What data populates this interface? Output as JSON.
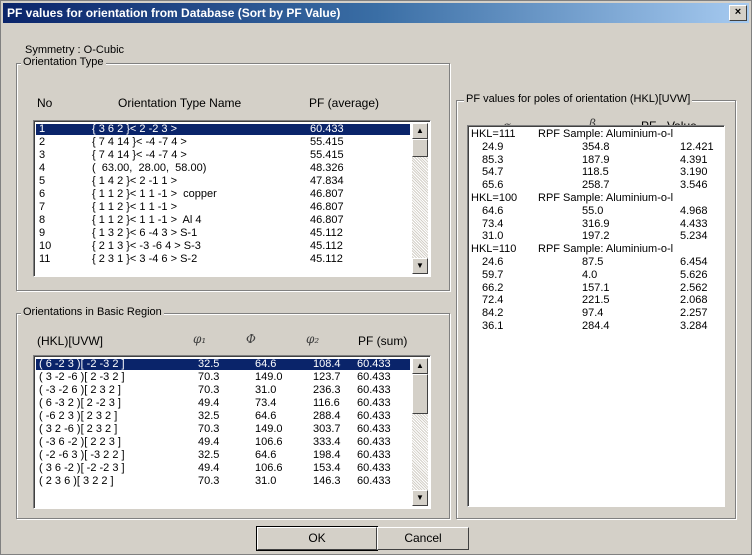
{
  "window": {
    "title": "PF values for orientation from Database (Sort by PF Value)",
    "close_label": "×"
  },
  "symmetry": "Symmetry :  O-Cubic",
  "orientation_type": {
    "legend": "Orientation Type",
    "col_no": "No",
    "col_name": "Orientation Type Name",
    "col_pf": "PF  (average)",
    "rows": [
      {
        "no": "1",
        "name": "{ 3 6 2 }< 2 -2 3 >",
        "pf": "60.433"
      },
      {
        "no": "2",
        "name": "{ 7 4 14 }< -4 -7 4 >",
        "pf": "55.415"
      },
      {
        "no": "3",
        "name": "{ 7 4 14 }< -4 -7 4 >",
        "pf": "55.415"
      },
      {
        "no": "4",
        "name": "(  63.00,  28.00,  58.00)",
        "pf": "48.326"
      },
      {
        "no": "5",
        "name": "{ 1 4 2 }< 2 -1 1 >",
        "pf": "47.834"
      },
      {
        "no": "6",
        "name": "{ 1 1 2 }< 1 1 -1 >  copper",
        "pf": "46.807"
      },
      {
        "no": "7",
        "name": "{ 1 1 2 }< 1 1 -1 >",
        "pf": "46.807"
      },
      {
        "no": "8",
        "name": "{ 1 1 2 }< 1 1 -1 >  Al 4",
        "pf": "46.807"
      },
      {
        "no": "9",
        "name": "{ 1 3 2 }< 6 -4 3 > S-1",
        "pf": "45.112"
      },
      {
        "no": "10",
        "name": "{ 2 1 3 }< -3 -6 4 > S-3",
        "pf": "45.112"
      },
      {
        "no": "11",
        "name": "{ 2 3 1 }< 3 -4 6 > S-2",
        "pf": "45.112"
      }
    ]
  },
  "basic_region": {
    "legend": "Orientations in Basic Region",
    "col_hkl": "(HKL)[UVW]",
    "col_phi1": "φ₁",
    "col_Phi": "Φ",
    "col_phi2": "φ₂",
    "col_pf": "PF  (sum)",
    "rows": [
      {
        "hkl": "( 6 -2 3 )[ -2 -3 2 ]",
        "p1": "32.5",
        "P": "64.6",
        "p2": "108.4",
        "pf": "60.433"
      },
      {
        "hkl": "( 3 -2 -6 )[ 2 -3 2 ]",
        "p1": "70.3",
        "P": "149.0",
        "p2": "123.7",
        "pf": "60.433"
      },
      {
        "hkl": "( -3 -2 6 )[ 2 3 2 ]",
        "p1": "70.3",
        "P": "31.0",
        "p2": "236.3",
        "pf": "60.433"
      },
      {
        "hkl": "( 6 -3 2 )[ 2 -2 3 ]",
        "p1": "49.4",
        "P": "73.4",
        "p2": "116.6",
        "pf": "60.433"
      },
      {
        "hkl": "( -6 2 3 )[ 2 3 2 ]",
        "p1": "32.5",
        "P": "64.6",
        "p2": "288.4",
        "pf": "60.433"
      },
      {
        "hkl": "( 3 2 -6 )[ 2 3 2 ]",
        "p1": "70.3",
        "P": "149.0",
        "p2": "303.7",
        "pf": "60.433"
      },
      {
        "hkl": "( -3 6 -2 )[ 2 2 3 ]",
        "p1": "49.4",
        "P": "106.6",
        "p2": "333.4",
        "pf": "60.433"
      },
      {
        "hkl": "( -2 -6 3 )[ -3 2 2 ]",
        "p1": "32.5",
        "P": "64.6",
        "p2": "198.4",
        "pf": "60.433"
      },
      {
        "hkl": "( 3 6 -2 )[ -2 -2 3 ]",
        "p1": "49.4",
        "P": "106.6",
        "p2": "153.4",
        "pf": "60.433"
      },
      {
        "hkl": "( 2 3 6 )[ 3 2 2 ]",
        "p1": "70.3",
        "P": "31.0",
        "p2": "146.3",
        "pf": "60.433"
      }
    ]
  },
  "pf_values": {
    "legend": "PF values for poles of orientation (HKL)[UVW]",
    "col_alpha": "α",
    "col_beta": "β",
    "col_value": "PF - Value",
    "sections": [
      {
        "header_hkl": "HKL=111",
        "header_sample": "RPF Sample: Aluminium-o-l",
        "rows": [
          {
            "a": "24.9",
            "b": "354.8",
            "v": "12.421"
          },
          {
            "a": "85.3",
            "b": "187.9",
            "v": "4.391"
          },
          {
            "a": "54.7",
            "b": "118.5",
            "v": "3.190"
          },
          {
            "a": "65.6",
            "b": "258.7",
            "v": "3.546"
          }
        ]
      },
      {
        "header_hkl": "HKL=100",
        "header_sample": "RPF Sample: Aluminium-o-l",
        "rows": [
          {
            "a": "64.6",
            "b": "55.0",
            "v": "4.968"
          },
          {
            "a": "73.4",
            "b": "316.9",
            "v": "4.433"
          },
          {
            "a": "31.0",
            "b": "197.2",
            "v": "5.234"
          }
        ]
      },
      {
        "header_hkl": "HKL=110",
        "header_sample": "RPF Sample: Aluminium-o-l",
        "rows": [
          {
            "a": "24.6",
            "b": "87.5",
            "v": "6.454"
          },
          {
            "a": "59.7",
            "b": "4.0",
            "v": "5.626"
          },
          {
            "a": "66.2",
            "b": "157.1",
            "v": "2.562"
          },
          {
            "a": "72.4",
            "b": "221.5",
            "v": "2.068"
          },
          {
            "a": "84.2",
            "b": "97.4",
            "v": "2.257"
          },
          {
            "a": "36.1",
            "b": "284.4",
            "v": "3.284"
          }
        ]
      }
    ]
  },
  "buttons": {
    "ok": "OK",
    "cancel": "Cancel"
  }
}
